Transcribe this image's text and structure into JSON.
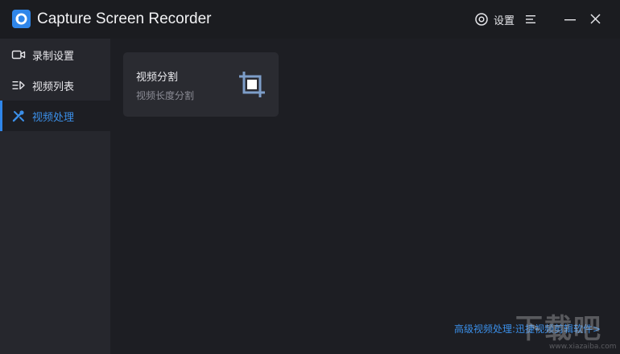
{
  "app": {
    "title": "Capture Screen Recorder",
    "logo_icon": "camera-record-icon",
    "accent": "#2f86ea"
  },
  "header": {
    "settings_label": "设置"
  },
  "sidebar": {
    "items": [
      {
        "label": "录制设置",
        "icon": "video-camera-icon",
        "active": false
      },
      {
        "label": "视频列表",
        "icon": "list-icon",
        "active": false
      },
      {
        "label": "视频处理",
        "icon": "tools-icon",
        "active": true
      }
    ]
  },
  "main": {
    "card": {
      "title": "视频分割",
      "subtitle": "视频长度分割",
      "icon": "crop-icon"
    },
    "footer_link": "高级视频处理:迅捷视频剪辑软件>"
  },
  "watermark": {
    "text": "下载吧",
    "url": "www.xiazaiba.com"
  }
}
